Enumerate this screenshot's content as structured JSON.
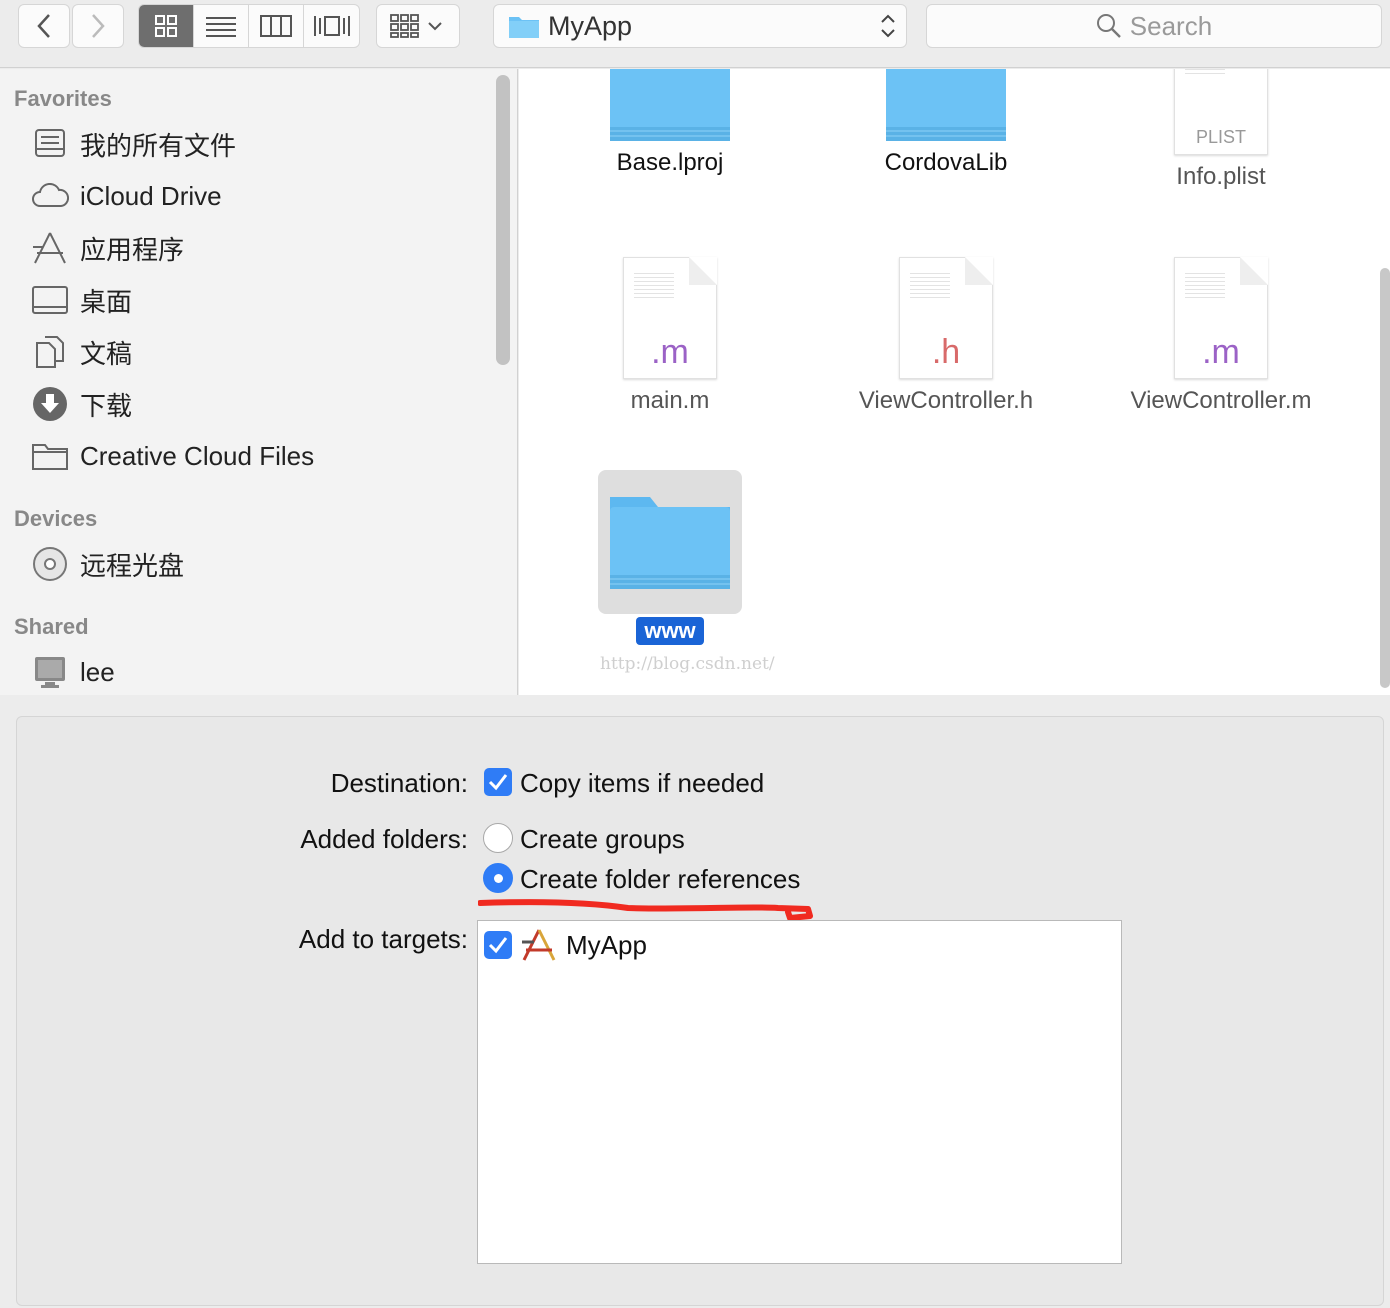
{
  "toolbar": {
    "path_title": "MyApp",
    "search_placeholder": "Search"
  },
  "sidebar": {
    "favorites_heading": "Favorites",
    "favorites": [
      {
        "label": "我的所有文件",
        "icon": "all-files-icon"
      },
      {
        "label": "iCloud Drive",
        "icon": "cloud-icon"
      },
      {
        "label": "应用程序",
        "icon": "applications-icon"
      },
      {
        "label": "桌面",
        "icon": "desktop-icon"
      },
      {
        "label": "文稿",
        "icon": "documents-icon"
      },
      {
        "label": "下载",
        "icon": "downloads-icon"
      },
      {
        "label": "Creative Cloud Files",
        "icon": "folder-icon"
      }
    ],
    "devices_heading": "Devices",
    "devices": [
      {
        "label": "远程光盘",
        "icon": "remote-disc-icon"
      }
    ],
    "shared_heading": "Shared",
    "shared": [
      {
        "label": "lee",
        "icon": "computer-icon"
      }
    ]
  },
  "files": [
    {
      "name": "Base.lproj",
      "kind": "folder"
    },
    {
      "name": "CordovaLib",
      "kind": "folder"
    },
    {
      "name": "Info.plist",
      "kind": "plist",
      "ext": "PLIST"
    },
    {
      "name": "main.m",
      "kind": "doc",
      "ext": ".m"
    },
    {
      "name": "ViewController.h",
      "kind": "doc",
      "ext": ".h"
    },
    {
      "name": "ViewController.m",
      "kind": "doc",
      "ext": ".m"
    },
    {
      "name": "www",
      "kind": "folder",
      "selected": true
    }
  ],
  "watermark": "http://blog.csdn.net/",
  "options": {
    "destination_label": "Destination:",
    "copy_items": "Copy items if needed",
    "copy_checked": true,
    "added_folders_label": "Added folders:",
    "create_groups": "Create groups",
    "create_folder_refs": "Create folder references",
    "selected_folder_option": "Create folder references",
    "add_targets_label": "Add to targets:",
    "targets": [
      {
        "name": "MyApp",
        "checked": true
      }
    ]
  },
  "colors": {
    "accent": "#2f7cf6",
    "selection": "#1a64d6",
    "folder": "#6cc2f5",
    "annotation": "#f02a20"
  }
}
